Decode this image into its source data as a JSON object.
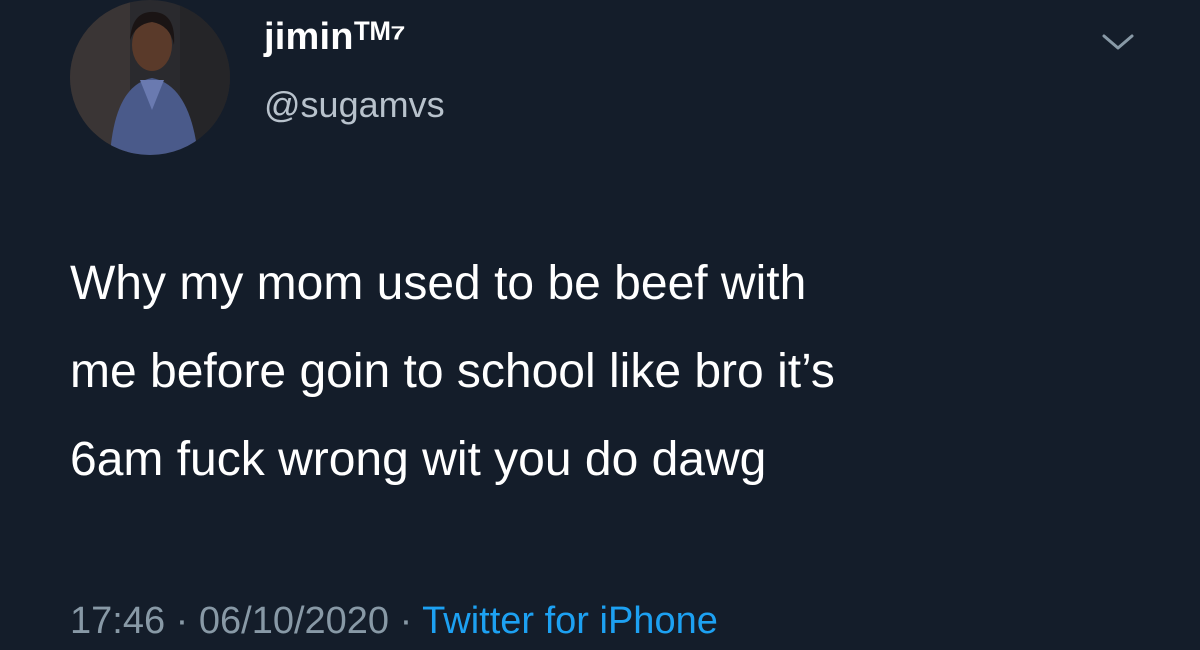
{
  "user": {
    "display_name": "jiminᵀᴹ⁷",
    "handle": "@sugamvs"
  },
  "tweet": {
    "lines": [
      "Why my mom used to be beef with",
      "me before goin to school like bro it’s",
      "6am fuck wrong wit you do dawg"
    ]
  },
  "meta": {
    "time": "17:46",
    "separator": " · ",
    "date": "06/10/2020",
    "source": "Twitter for iPhone"
  },
  "icons": {
    "menu": "chevron-down-icon"
  },
  "colors": {
    "background": "#141d2a",
    "text": "#ffffff",
    "secondary_text": "#8899a6",
    "link": "#1da1f2"
  }
}
